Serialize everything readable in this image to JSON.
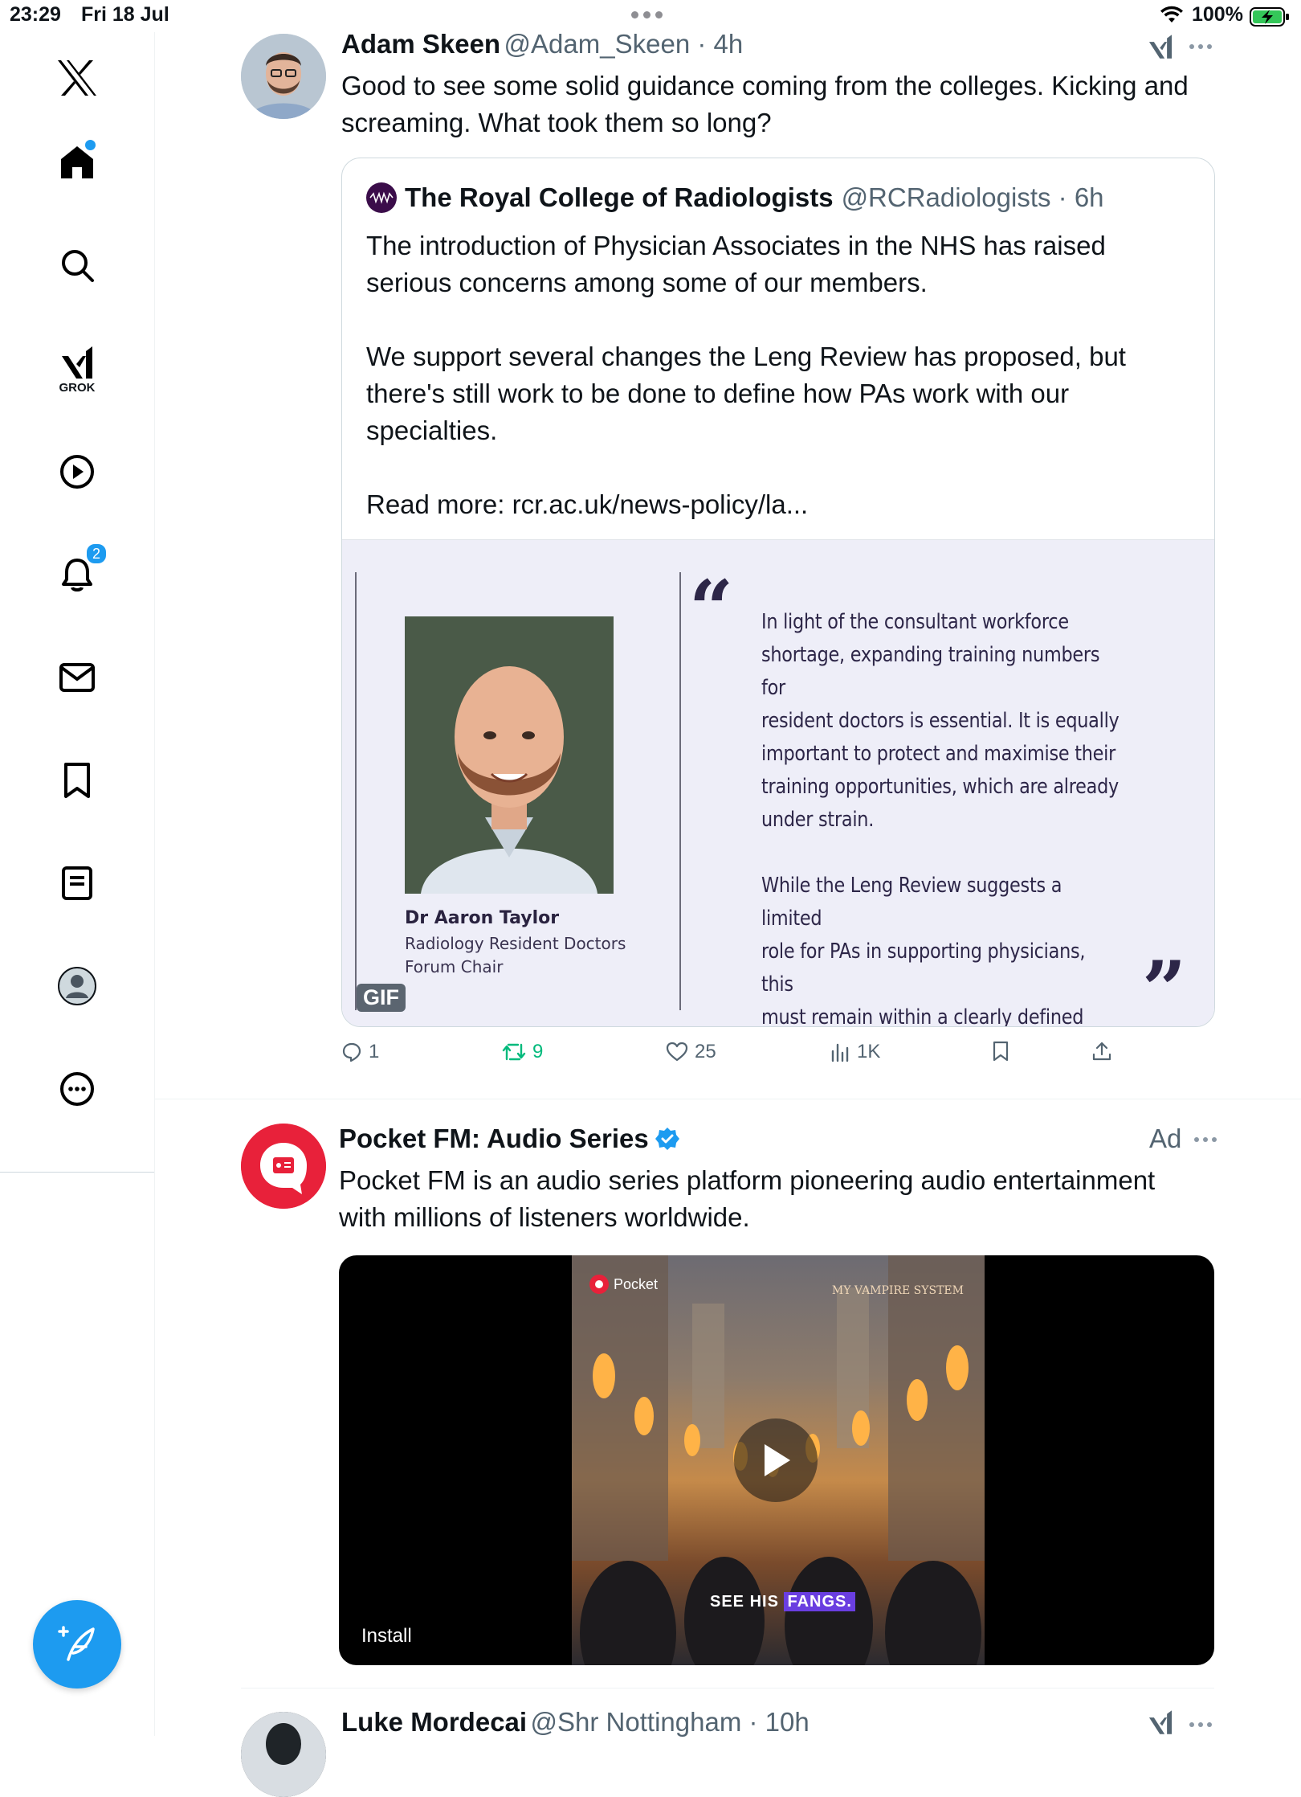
{
  "status_bar": {
    "time": "23:29",
    "date": "Fri 18 Jul",
    "battery": "100%"
  },
  "sidebar": {
    "items": [
      {
        "icon": "x-logo-icon"
      },
      {
        "icon": "home-icon"
      },
      {
        "icon": "search-icon"
      },
      {
        "icon": "grok-icon",
        "label": "GROK"
      },
      {
        "icon": "play-icon"
      },
      {
        "icon": "bell-icon",
        "badge": "2"
      },
      {
        "icon": "mail-icon"
      },
      {
        "icon": "bookmark-icon"
      },
      {
        "icon": "list-icon"
      },
      {
        "icon": "profile-icon"
      },
      {
        "icon": "more-icon"
      }
    ],
    "compose_icon": "compose-icon"
  },
  "tweet1": {
    "name": "Adam Skeen",
    "handle": "@Adam_Skeen",
    "time": "4h",
    "text": "Good to see some solid guidance coming from the colleges. Kicking and\nscreaming. What took them so long?",
    "quote": {
      "name": "The Royal College of Radiologists",
      "handle": "@RCRadiologists",
      "time": "6h",
      "text": "The introduction of Physician Associates in the NHS has raised\nserious concerns among some of our members.\n\nWe support several changes the Leng Review has proposed, but\nthere's still work to be done to define how PAs work with our\nspecialties.\n\nRead more: rcr.ac.uk/news-policy/la...",
      "image": {
        "person_name": "Dr Aaron Taylor",
        "person_role_line1": "Radiology Resident Doctors",
        "person_role_line2": "Forum Chair",
        "quote_text": "In light of the consultant workforce\nshortage, expanding training numbers for\nresident doctors is essential. It is equally\nimportant to protect and maximise their\ntraining opportunities, which are already\nunder strain.\n\nWhile the Leng Review suggests a limited\nrole for PAs in supporting physicians, this\nmust remain within a clearly defined scope\nthat does not compromise resident\ndoctors’ training.",
        "gif_label": "GIF"
      }
    },
    "actions": {
      "replies": "1",
      "retweets": "9",
      "likes": "25",
      "views": "1K"
    }
  },
  "tweet2": {
    "name": "Pocket FM: Audio Series",
    "ad_label": "Ad",
    "text": "Pocket FM is an audio series platform pioneering audio entertainment\nwith millions of listeners worldwide.",
    "video": {
      "install_label": "Install",
      "frame_brand": "Pocket",
      "frame_title": "MY VAMPIRE SYSTEM",
      "caption_plain": "SEE HIS",
      "caption_highlight": "FANGS."
    }
  },
  "tweet3": {
    "name": "Luke Mordecai",
    "handle": "@Shr Nottingham",
    "time": "10h"
  },
  "colors": {
    "accent": "#1d9bf0",
    "retweet_green": "#00ba7c",
    "pocketfm_red": "#e8213a"
  }
}
